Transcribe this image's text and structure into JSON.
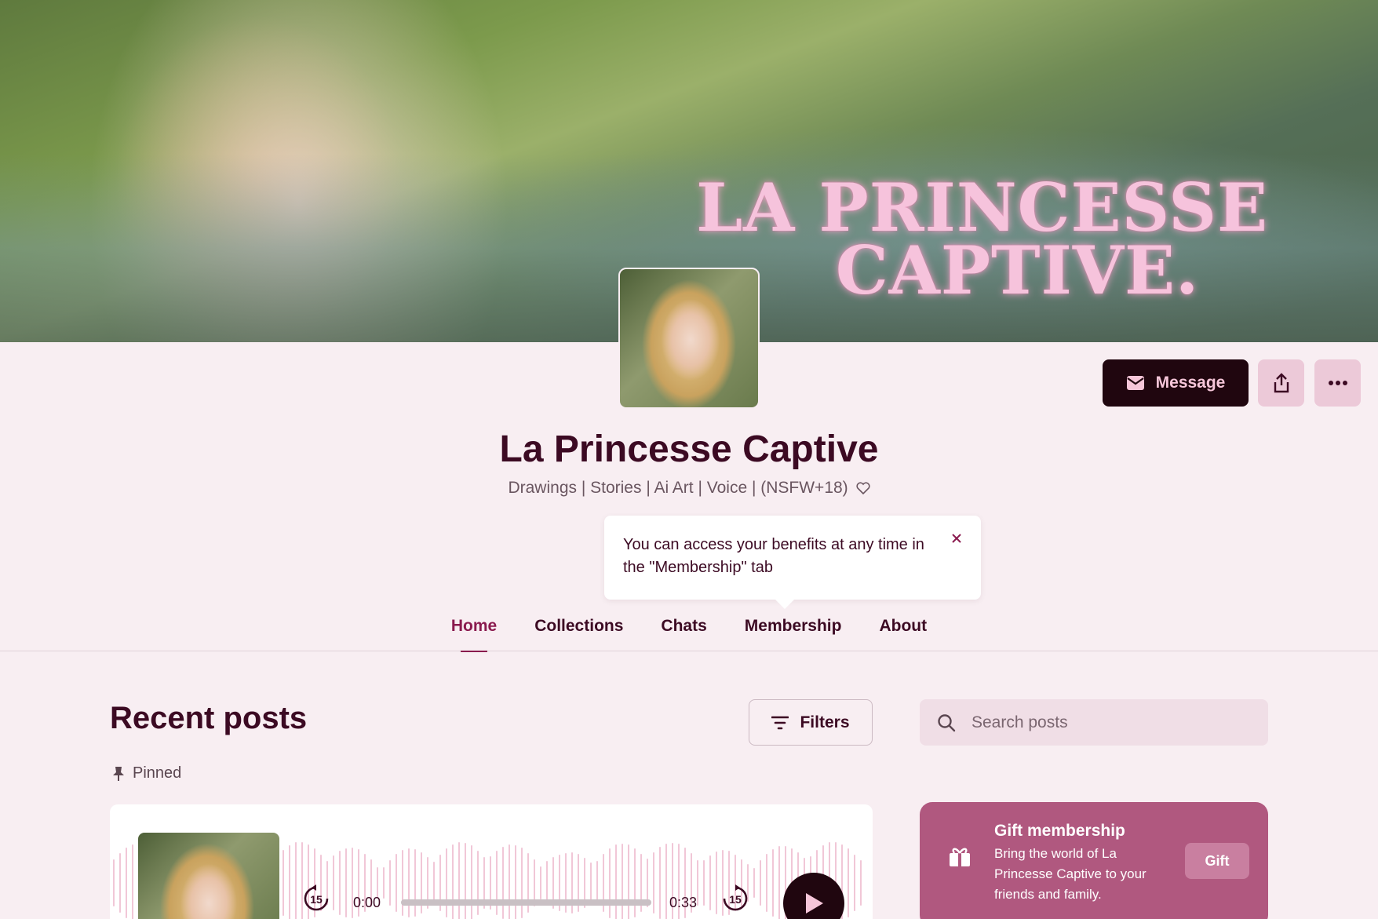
{
  "banner": {
    "title_line1": "LA PRINCESSE",
    "title_line2": "CAPTIVE.",
    "title_color": "#f6c3dc"
  },
  "profile": {
    "name": "La Princesse Captive",
    "tagline": "Drawings | Stories | Ai Art | Voice | (NSFW+18)",
    "tagline_icon": "heart-outline-icon"
  },
  "actions": {
    "message_label": "Message",
    "message_icon": "envelope-icon",
    "share_icon": "share-icon",
    "more_icon": "more-horizontal-icon"
  },
  "tooltip": {
    "text": "You can access your benefits at any time in the \"Membership\" tab",
    "close_icon": "close-icon"
  },
  "tabs": [
    {
      "label": "Home",
      "active": true
    },
    {
      "label": "Collections",
      "active": false
    },
    {
      "label": "Chats",
      "active": false
    },
    {
      "label": "Membership",
      "active": false
    },
    {
      "label": "About",
      "active": false
    }
  ],
  "posts": {
    "section_title": "Recent posts",
    "filters_label": "Filters",
    "search_placeholder": "Search posts",
    "pinned_label": "Pinned",
    "audio": {
      "current_time": "0:00",
      "duration": "0:33",
      "skip_back_label": "15",
      "skip_forward_label": "15",
      "progress_fraction": 0
    }
  },
  "gift": {
    "title": "Gift membership",
    "description": "Bring the world of La Princesse Captive to your friends and family.",
    "button_label": "Gift",
    "icon": "gift-icon"
  },
  "colors": {
    "page_bg": "#f8eef2",
    "accent": "#8a1a4e",
    "dark": "#20060f",
    "gift_bg": "#b0587f"
  }
}
